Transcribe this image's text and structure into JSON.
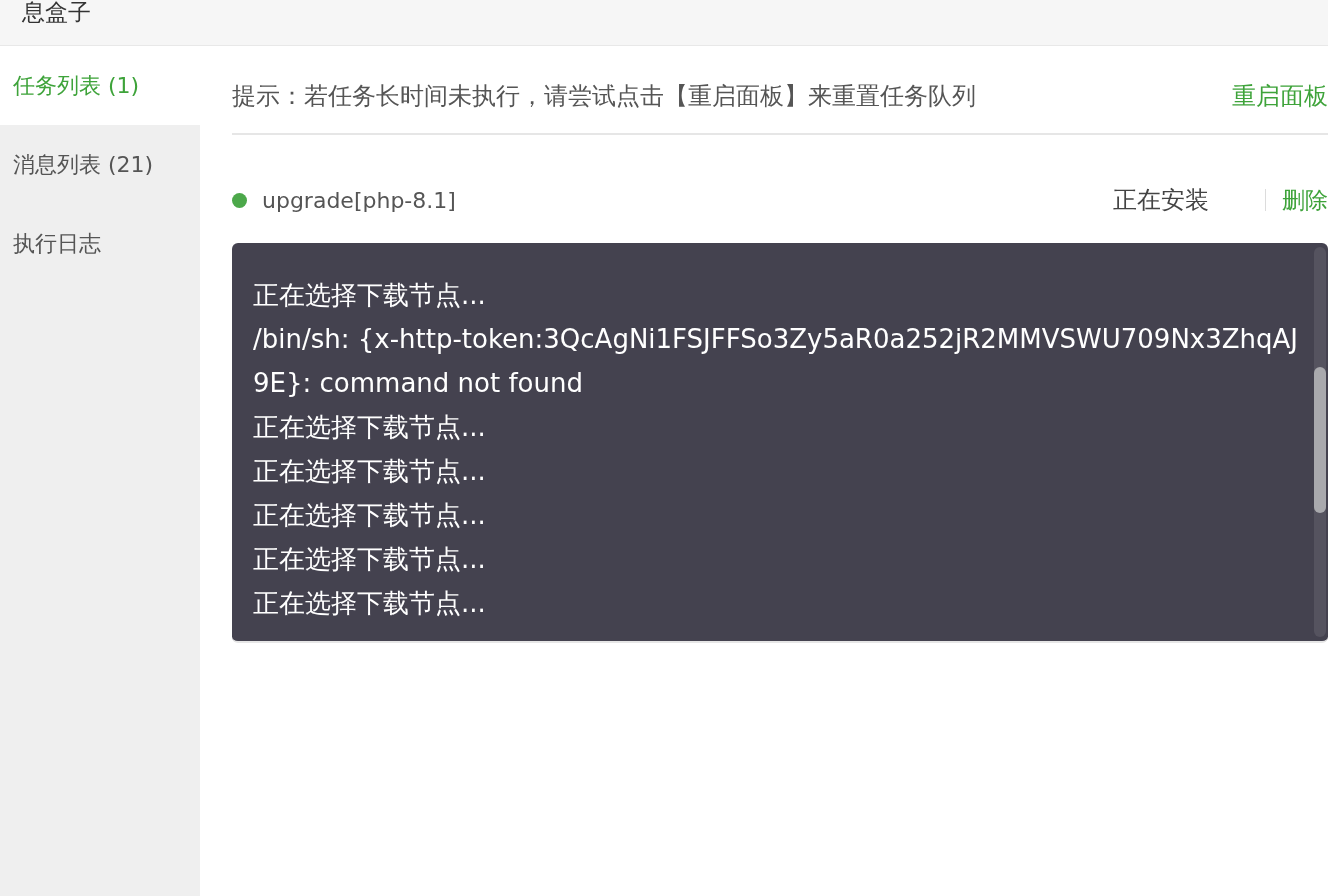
{
  "header": {
    "title": "息盒子"
  },
  "sidebar": {
    "items": [
      {
        "label": "任务列表 (1)",
        "selected": true
      },
      {
        "label": "消息列表 (21)",
        "selected": false
      },
      {
        "label": "执行日志",
        "selected": false
      }
    ]
  },
  "hint": {
    "text": "提示：若任务长时间未执行，请尝试点击【重启面板】来重置任务队列",
    "action": "重启面板"
  },
  "tasks": [
    {
      "name": "upgrade[php-8.1]",
      "color": "#4ca84a",
      "status": "正在安装",
      "action": "删除",
      "log": [
        "正在选择下载节点...",
        "/bin/sh: {x-http-token:3QcAgNi1FSJFFSo3Zy5aR0a252jR2MMVSWU709Nx3ZhqAJ9E}: command not found",
        "正在选择下载节点...",
        "正在选择下载节点...",
        "正在选择下载节点...",
        "正在选择下载节点...",
        "正在选择下载节点..."
      ]
    }
  ]
}
